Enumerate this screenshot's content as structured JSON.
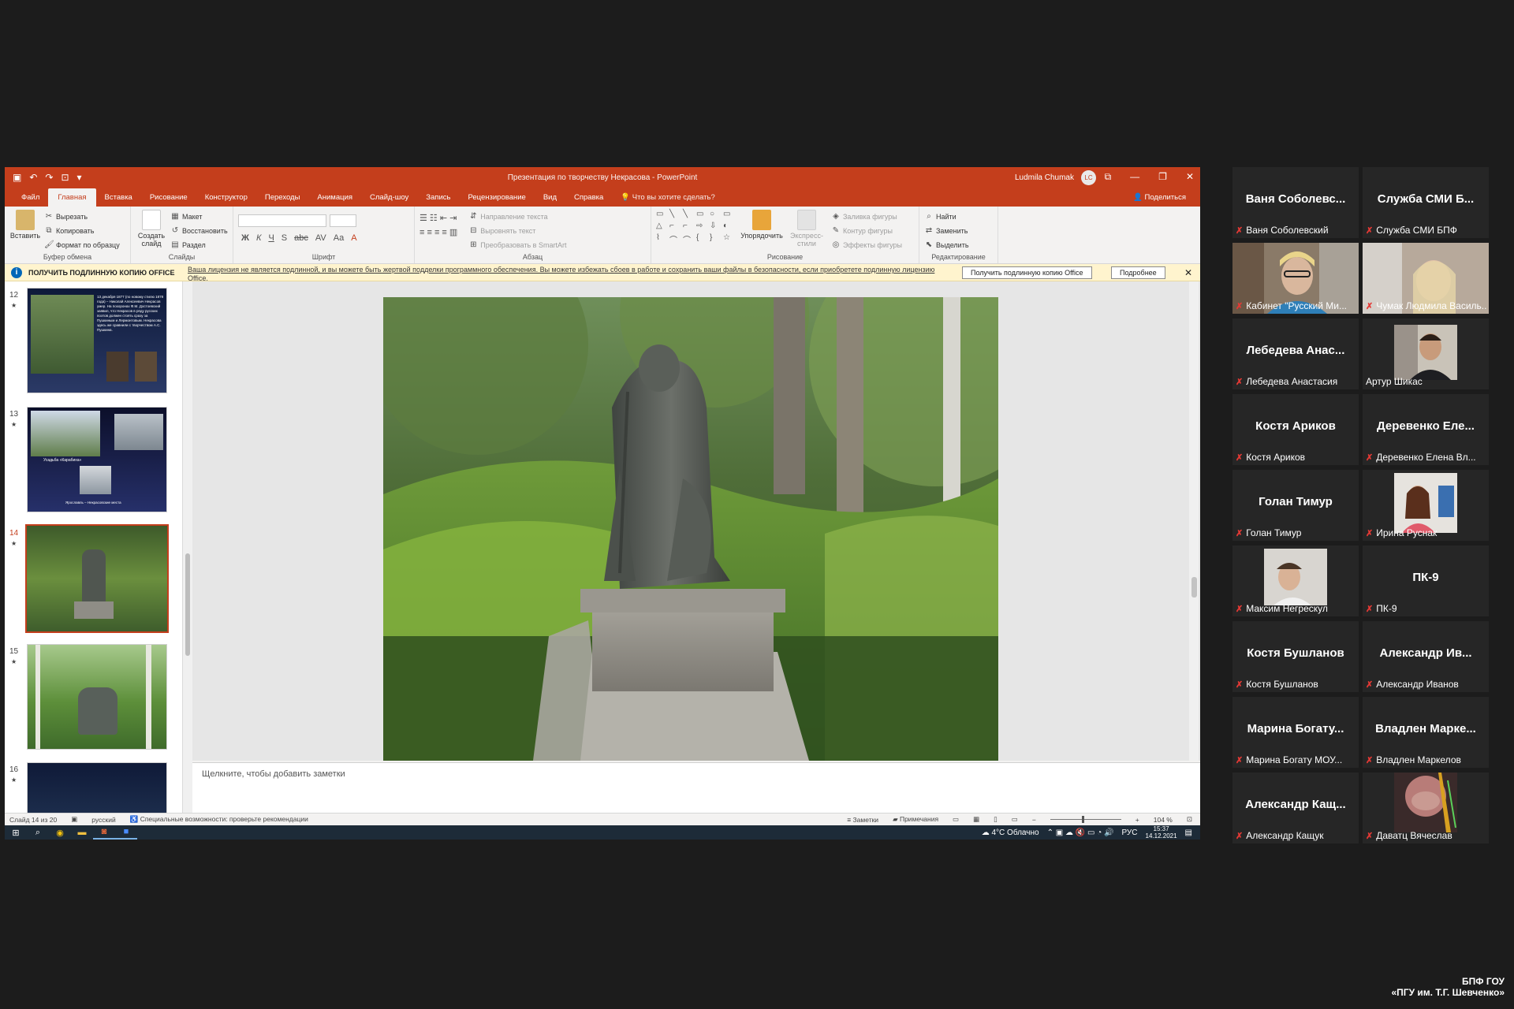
{
  "ppt": {
    "quick_access": [
      "▣",
      "↶",
      "↷",
      "⊡",
      "▾"
    ],
    "doc_title": "Презентация по творчеству Некрасова - PowerPoint",
    "user_name": "Ludmila Chumak",
    "user_initials": "LC",
    "window_buttons": [
      "⧉",
      "—",
      "❐",
      "✕"
    ],
    "tabs": [
      "Файл",
      "Главная",
      "Вставка",
      "Рисование",
      "Конструктор",
      "Переходы",
      "Анимация",
      "Слайд-шоу",
      "Запись",
      "Рецензирование",
      "Вид",
      "Справка"
    ],
    "tell_me": "Что вы хотите сделать?",
    "share": "Поделиться",
    "ribbon": {
      "clipboard": {
        "paste": "Вставить",
        "cut": "Вырезать",
        "copy": "Копировать",
        "format_painter": "Формат по образцу",
        "group": "Буфер обмена"
      },
      "slides": {
        "new_slide": "Создать слайд",
        "layout": "Макет",
        "reset": "Восстановить",
        "section": "Раздел",
        "group": "Слайды"
      },
      "font": {
        "group": "Шрифт",
        "glyphs": [
          "Ж",
          "К",
          "Ч",
          "S",
          "abc",
          "AV",
          "Aa",
          "A"
        ]
      },
      "paragraph": {
        "text_direction": "Направление текста",
        "align_text": "Выровнять текст",
        "smartart": "Преобразовать в SmartArt",
        "group": "Абзац"
      },
      "drawing": {
        "arrange": "Упорядочить",
        "quick_styles": "Экспресс-стили",
        "shape_fill": "Заливка фигуры",
        "shape_outline": "Контур фигуры",
        "shape_effects": "Эффекты фигуры",
        "group": "Рисование",
        "shapes": [
          "▭",
          "╲",
          "╲",
          "▭",
          "○",
          "▭",
          "△",
          "⌐",
          "⌐",
          "⇨",
          "⇩",
          "◐",
          "⌇",
          "⌒",
          "⌒",
          "{",
          "}",
          "☆"
        ]
      },
      "editing": {
        "find": "Найти",
        "replace": "Заменить",
        "select": "Выделить",
        "group": "Редактирование"
      }
    },
    "message_bar": {
      "heading": "ПОЛУЧИТЬ ПОДЛИННУЮ КОПИЮ OFFICE",
      "text": "Ваша лицензия не является подлинной, и вы можете быть жертвой подделки программного обеспечения. Вы можете избежать сбоев в работе и сохранить ваши файлы в безопасности, если приобретете подлинную лицензию Office.",
      "get_button": "Получить подлинную копию Office",
      "more_button": "Подробнее"
    },
    "thumbnails": [
      {
        "num": "12",
        "caption": "13 декабря 1877 (по новому стилю 1878 года) – Николай Алексеевич Некрасов умер. На похоронах Ф.М. Достоевский заявил, что Некрасов в ряду русских поэтов должен стоять сразу за Пушкиным и Лермонтовым. Некрасова здесь же сравнили с творчеством А.С. Пушкина."
      },
      {
        "num": "13",
        "caption": "Усадьба «Карабиха»",
        "caption2": "Ярославль – Некрасовские места"
      },
      {
        "num": "14",
        "caption": ""
      },
      {
        "num": "15",
        "caption": ""
      },
      {
        "num": "16",
        "caption": ""
      }
    ],
    "notes_placeholder": "Щелкните, чтобы добавить заметки",
    "status": {
      "slide_info": "Слайд 14 из 20",
      "language": "русский",
      "accessibility": "Специальные возможности: проверьте рекомендации",
      "notes": "Заметки",
      "comments": "Примечания",
      "zoom": "104 %"
    },
    "taskbar": {
      "weather": "4°C  Облачно",
      "lang": "РУС",
      "time": "15:37",
      "date": "14.12.2021"
    }
  },
  "participants": [
    {
      "big": "Ваня  Соболевс...",
      "label": "Ваня Соболевский",
      "video": false
    },
    {
      "big": "Служба СМИ Б...",
      "label": "Служба СМИ БПФ",
      "video": false
    },
    {
      "big": "",
      "label": "Кабинет \"Русский Ми...",
      "video": true,
      "scene": "woman-glasses"
    },
    {
      "big": "",
      "label": "Чумак Людмила Василь...",
      "video": true,
      "scene": "woman-blonde"
    },
    {
      "big": "Лебедева  Анас...",
      "label": "Лебедева Анастасия",
      "video": false
    },
    {
      "big": "",
      "label": "Артур Шикас",
      "video": true,
      "scene": "young-man",
      "active": true
    },
    {
      "big": "Костя Ариков",
      "label": "Костя Ариков",
      "video": false
    },
    {
      "big": "Деревенко  Еле...",
      "label": "Деревенко Елена Вл...",
      "video": false
    },
    {
      "big": "Голан Тимур",
      "label": "Голан Тимур",
      "video": false
    },
    {
      "big": "",
      "label": "Ирина Руснак",
      "video": true,
      "scene": "woman-desk"
    },
    {
      "big": "",
      "label": "Максим Негрескул",
      "video": true,
      "scene": "student"
    },
    {
      "big": "ПК-9",
      "label": "ПК-9",
      "video": false
    },
    {
      "big": "Костя Бушланов",
      "label": "Костя Бушланов",
      "video": false
    },
    {
      "big": "Александр  Ив...",
      "label": "Александр Иванов",
      "video": false
    },
    {
      "big": "Марина  Богату...",
      "label": "Марина Богату МОУ...",
      "video": false
    },
    {
      "big": "Владлен  Марке...",
      "label": "Владлен Маркелов",
      "video": false
    },
    {
      "big": "Александр  Кащ...",
      "label": "Александр Кащук",
      "video": false
    },
    {
      "big": "",
      "label": "Даватц Вячеслав",
      "video": true,
      "scene": "face-closeup"
    }
  ],
  "watermark": {
    "line1": "БПФ ГОУ",
    "line2": "«ПГУ им. Т.Г. Шевченко»"
  }
}
